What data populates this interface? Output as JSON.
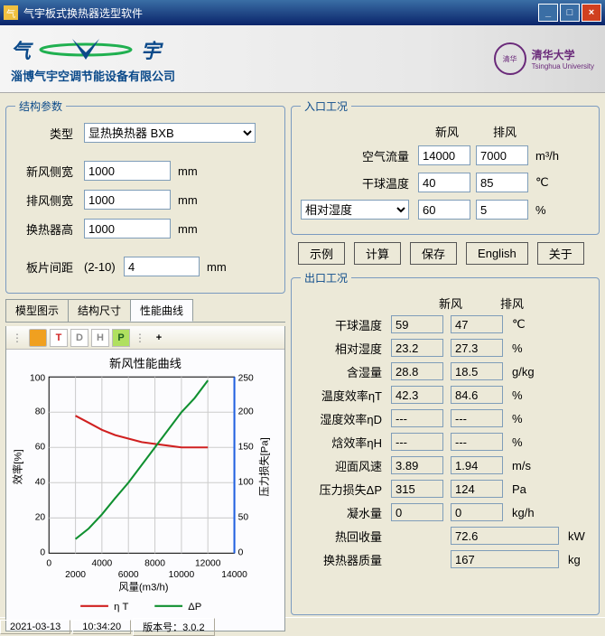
{
  "window": {
    "title": "气宇板式换热器选型软件"
  },
  "banner": {
    "qi": "气",
    "yu": "宇",
    "company": "淄博气宇空调节能设备有限公司",
    "uni_cn": "清华大学",
    "uni_en": "Tsinghua University"
  },
  "struct": {
    "legend": "结构参数",
    "type_label": "类型",
    "type_value": "显热换热器 BXB",
    "fresh_w_label": "新风侧宽",
    "fresh_w": "1000",
    "exhaust_w_label": "排风侧宽",
    "exhaust_w": "1000",
    "height_label": "换热器高",
    "height": "1000",
    "mm": "mm",
    "pitch_label": "板片间距",
    "pitch_range": "(2-10)",
    "pitch": "4"
  },
  "tabs": {
    "model": "模型图示",
    "dims": "结构尺寸",
    "curve": "性能曲线"
  },
  "toolbar": {
    "T": "T",
    "D": "D",
    "H": "H",
    "P": "P",
    "plus": "+"
  },
  "inlet": {
    "legend": "入口工况",
    "fresh": "新风",
    "exhaust": "排风",
    "flow_label": "空气流量",
    "flow_fresh": "14000",
    "flow_exhaust": "7000",
    "flow_unit": "m³/h",
    "db_label": "干球温度",
    "db_fresh": "40",
    "db_exhaust": "85",
    "db_unit": "℃",
    "rh_mode": "相对湿度",
    "rh_fresh": "60",
    "rh_exhaust": "5",
    "rh_unit": "%"
  },
  "buttons": {
    "example": "示例",
    "calc": "计算",
    "save": "保存",
    "english": "English",
    "about": "关于"
  },
  "outlet": {
    "legend": "出口工况",
    "fresh": "新风",
    "exhaust": "排风",
    "db_label": "干球温度",
    "db_f": "59",
    "db_e": "47",
    "db_u": "℃",
    "rh_label": "相对湿度",
    "rh_f": "23.2",
    "rh_e": "27.3",
    "rh_u": "%",
    "hum_label": "含湿量",
    "hum_f": "28.8",
    "hum_e": "18.5",
    "hum_u": "g/kg",
    "tet_label": "温度效率ηT",
    "tet_f": "42.3",
    "tet_e": "84.6",
    "tet_u": "%",
    "hef_label": "湿度效率ηD",
    "hef_f": "---",
    "hef_e": "---",
    "hef_u": "%",
    "ent_label": "焓效率ηH",
    "ent_f": "---",
    "ent_e": "---",
    "ent_u": "%",
    "vel_label": "迎面风速",
    "vel_f": "3.89",
    "vel_e": "1.94",
    "vel_u": "m/s",
    "dp_label": "压力损失ΔP",
    "dp_f": "315",
    "dp_e": "124",
    "dp_u": "Pa",
    "cond_label": "凝水量",
    "cond_f": "0",
    "cond_e": "0",
    "cond_u": "kg/h",
    "heat_label": "热回收量",
    "heat": "72.6",
    "heat_u": "kW",
    "mass_label": "换热器质量",
    "mass": "167",
    "mass_u": "kg"
  },
  "status": {
    "date": "2021-03-13",
    "time": "10:34:20",
    "ver": "版本号：3.0.2"
  },
  "chart_data": {
    "type": "line",
    "title": "新风性能曲线",
    "xlabel": "风量(m3/h)",
    "ylabel_left": "效率[%]",
    "ylabel_right": "压力损失[Pa]",
    "xlim": [
      0,
      14000
    ],
    "ylim_left": [
      0,
      100
    ],
    "ylim_right": [
      0,
      250
    ],
    "xticks": [
      0,
      2000,
      4000,
      6000,
      8000,
      10000,
      12000,
      14000
    ],
    "yticks_left": [
      0,
      20,
      40,
      60,
      80,
      100
    ],
    "yticks_right": [
      0,
      50,
      100,
      150,
      200,
      250
    ],
    "series": [
      {
        "name": "η T",
        "axis": "left",
        "color": "#d02020",
        "x": [
          2000,
          3000,
          4000,
          5000,
          6000,
          7000,
          8000,
          9000,
          10000,
          11000,
          12000
        ],
        "values": [
          78,
          74,
          70,
          67,
          65,
          63,
          62,
          61,
          60,
          60,
          60
        ]
      },
      {
        "name": "ΔP",
        "axis": "right",
        "color": "#109030",
        "x": [
          2000,
          3000,
          4000,
          5000,
          6000,
          7000,
          8000,
          9000,
          10000,
          11000,
          12000
        ],
        "values": [
          20,
          35,
          55,
          78,
          100,
          125,
          150,
          175,
          200,
          220,
          245
        ]
      }
    ],
    "legend": [
      "η T",
      "ΔP"
    ]
  }
}
